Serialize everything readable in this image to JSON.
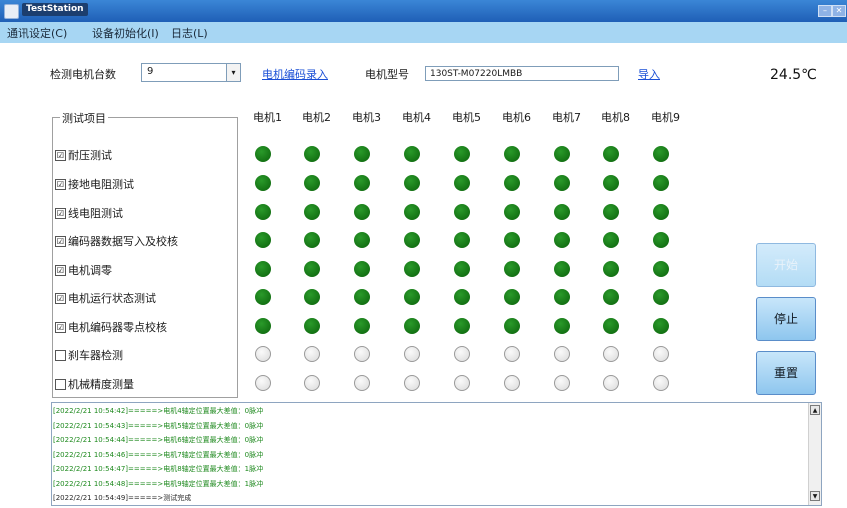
{
  "window": {
    "title": "TestStation",
    "minimize_glyph": "–",
    "close_glyph": "✕"
  },
  "menu": [
    {
      "label": "通讯设定(C)"
    },
    {
      "label": "设备初始化(I)"
    },
    {
      "label": "日志(L)"
    }
  ],
  "controls": {
    "motor_count_label": "检测电机台数",
    "motor_count_value": "9",
    "combo_arrow": "▾",
    "encoder_entry_link": "电机编码录入",
    "model_label": "电机型号",
    "model_value": "130ST-M07220LMBB",
    "import_link": "导入",
    "temperature": "24.5℃"
  },
  "test_group": {
    "title": "测试项目",
    "items": [
      {
        "label": "耐压测试",
        "checked": true,
        "mark": "☑"
      },
      {
        "label": "接地电阻测试",
        "checked": true,
        "mark": "☑"
      },
      {
        "label": "线电阻测试",
        "checked": true,
        "mark": "☑"
      },
      {
        "label": "编码器数据写入及校核",
        "checked": true,
        "mark": "☑"
      },
      {
        "label": "电机调零",
        "checked": true,
        "mark": "☑"
      },
      {
        "label": "电机运行状态测试",
        "checked": true,
        "mark": "☑"
      },
      {
        "label": "电机编码器零点校核",
        "checked": true,
        "mark": "☑"
      },
      {
        "label": "刹车器检测",
        "checked": false,
        "mark": ""
      },
      {
        "label": "机械精度测量",
        "checked": false,
        "mark": ""
      }
    ]
  },
  "motors": [
    "电机1",
    "电机2",
    "电机3",
    "电机4",
    "电机5",
    "电机6",
    "电机7",
    "电机8",
    "电机9"
  ],
  "status_colors": {
    "on": "#137a13",
    "off": "#e6e6e6"
  },
  "buttons": {
    "start": "开始",
    "stop": "停止",
    "reset": "重置"
  },
  "log": [
    "[2022/2/21 10:54:42]=====>电机4轴定位置最大差值：0脉冲",
    "[2022/2/21 10:54:43]=====>电机5轴定位置最大差值：0脉冲",
    "[2022/2/21 10:54:44]=====>电机6轴定位置最大差值：0脉冲",
    "[2022/2/21 10:54:46]=====>电机7轴定位置最大差值：0脉冲",
    "[2022/2/21 10:54:47]=====>电机8轴定位置最大差值：1脉冲",
    "[2022/2/21 10:54:48]=====>电机9轴定位置最大差值：1脉冲",
    "[2022/2/21 10:54:49]=====>测试完成"
  ],
  "log_scroll": {
    "up": "▲",
    "down": "▼"
  }
}
